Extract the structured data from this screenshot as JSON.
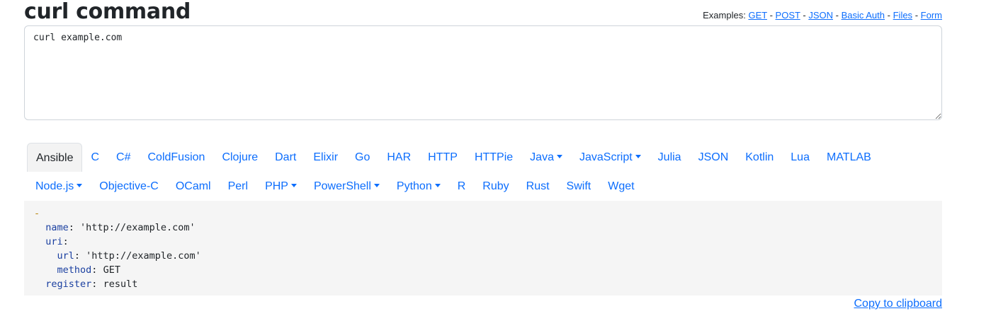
{
  "page": {
    "title": "curl command"
  },
  "examples": {
    "label": "Examples:",
    "links": [
      "GET",
      "POST",
      "JSON",
      "Basic Auth",
      "Files",
      "Form"
    ],
    "separator": "-"
  },
  "input": {
    "value": "curl example.com"
  },
  "tabs": {
    "items": [
      {
        "label": "Ansible",
        "active": true,
        "dropdown": false
      },
      {
        "label": "C",
        "dropdown": false
      },
      {
        "label": "C#",
        "dropdown": false
      },
      {
        "label": "ColdFusion",
        "dropdown": false
      },
      {
        "label": "Clojure",
        "dropdown": false
      },
      {
        "label": "Dart",
        "dropdown": false
      },
      {
        "label": "Elixir",
        "dropdown": false
      },
      {
        "label": "Go",
        "dropdown": false
      },
      {
        "label": "HAR",
        "dropdown": false
      },
      {
        "label": "HTTP",
        "dropdown": false
      },
      {
        "label": "HTTPie",
        "dropdown": false
      },
      {
        "label": "Java",
        "dropdown": true
      },
      {
        "label": "JavaScript",
        "dropdown": true
      },
      {
        "label": "Julia",
        "dropdown": false
      },
      {
        "label": "JSON",
        "dropdown": false
      },
      {
        "label": "Kotlin",
        "dropdown": false
      },
      {
        "label": "Lua",
        "dropdown": false
      },
      {
        "label": "MATLAB",
        "dropdown": false
      },
      {
        "label": "Node.js",
        "dropdown": true
      },
      {
        "label": "Objective-C",
        "dropdown": false
      },
      {
        "label": "OCaml",
        "dropdown": false
      },
      {
        "label": "Perl",
        "dropdown": false
      },
      {
        "label": "PHP",
        "dropdown": true
      },
      {
        "label": "PowerShell",
        "dropdown": true
      },
      {
        "label": "Python",
        "dropdown": true
      },
      {
        "label": "R",
        "dropdown": false
      },
      {
        "label": "Ruby",
        "dropdown": false
      },
      {
        "label": "Rust",
        "dropdown": false
      },
      {
        "label": "Swift",
        "dropdown": false
      },
      {
        "label": "Wget",
        "dropdown": false
      }
    ]
  },
  "code": {
    "dash": "-",
    "lines": [
      {
        "indent": "  ",
        "key": "name",
        "value": " 'http://example.com'"
      },
      {
        "indent": "  ",
        "key": "uri",
        "value": ""
      },
      {
        "indent": "    ",
        "key": "url",
        "value": " 'http://example.com'"
      },
      {
        "indent": "    ",
        "key": "method",
        "value": " GET"
      },
      {
        "indent": "  ",
        "key": "register",
        "value": " result"
      }
    ]
  },
  "copy": {
    "label": "Copy to clipboard"
  },
  "colors": {
    "link": "#0d6efd",
    "code_bg": "#f5f5f5",
    "dash": "#b8860b",
    "key": "#1a3fa0"
  }
}
